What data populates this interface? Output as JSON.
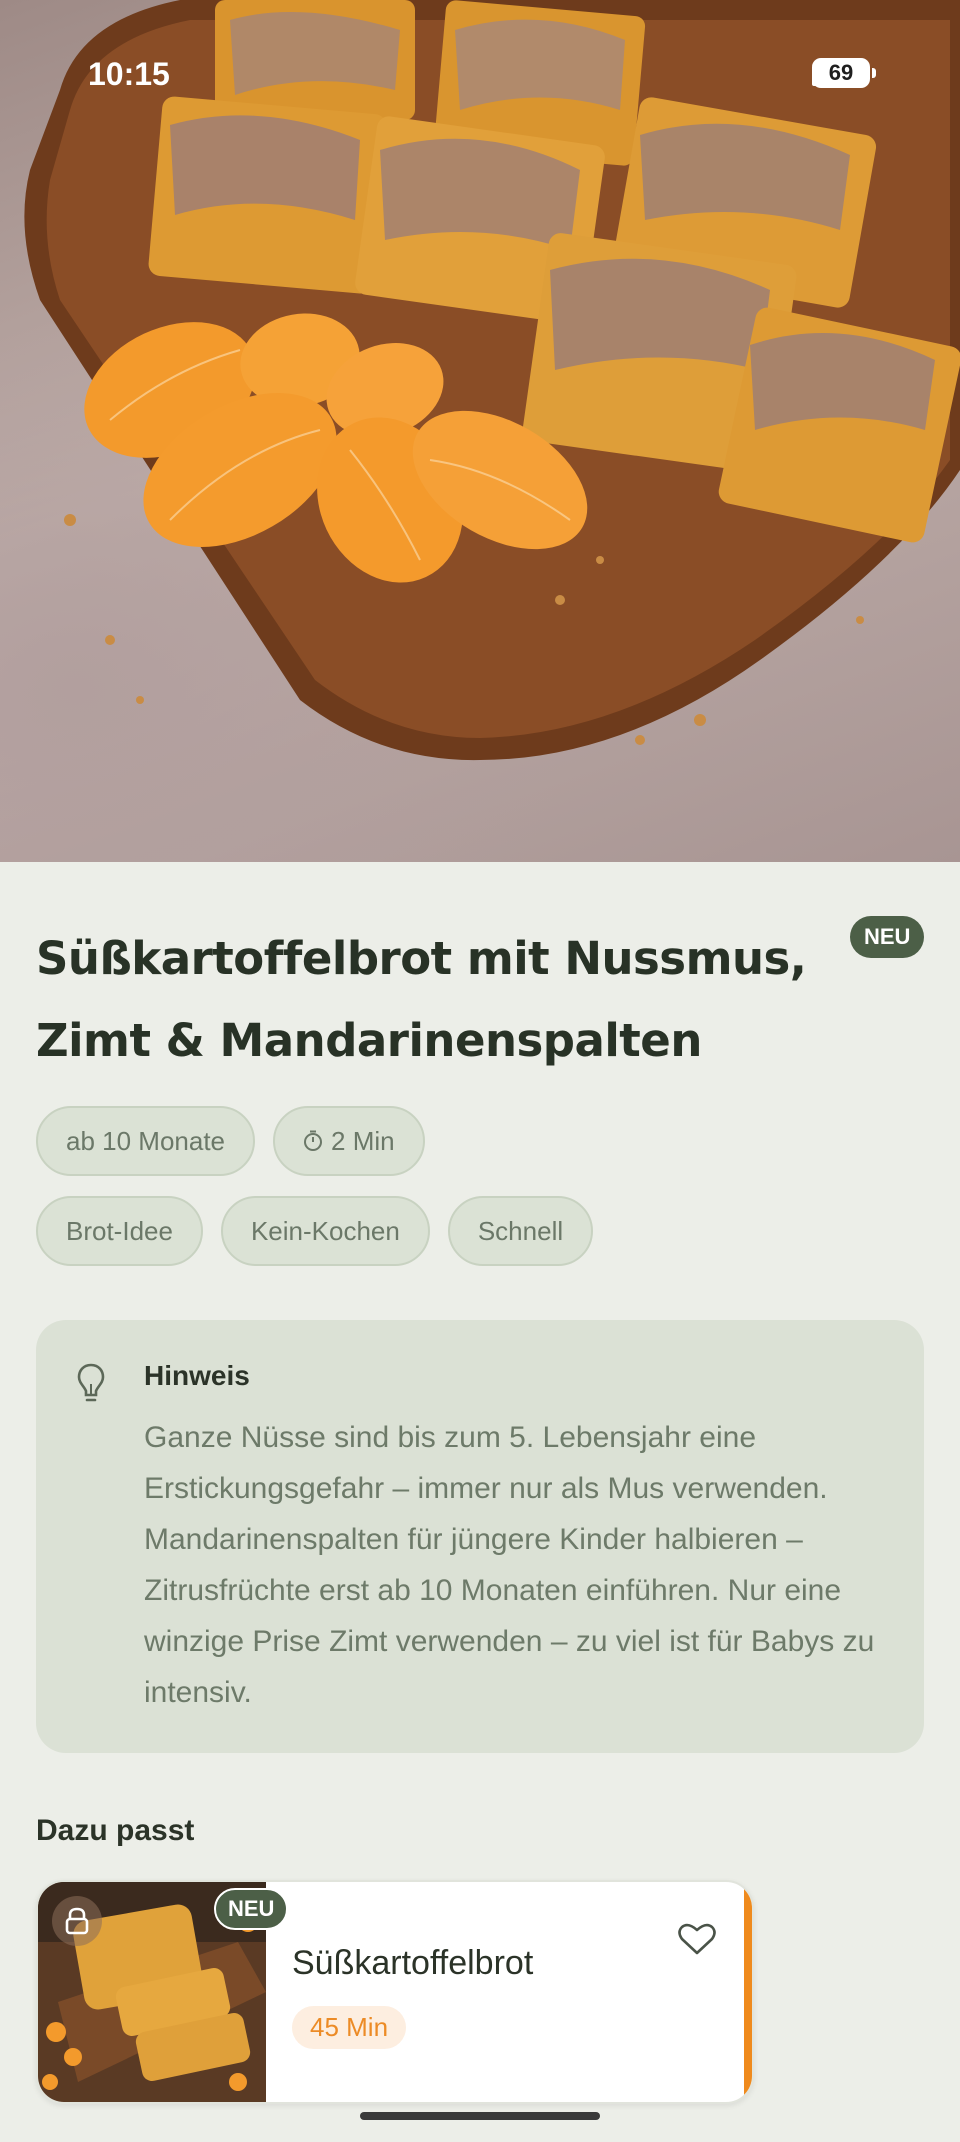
{
  "status_bar": {
    "time": "10:15",
    "battery": "69"
  },
  "recipe": {
    "title": "Süßkartoffelbrot mit Nussmus, Zimt & Mandarinenspalten",
    "badge": "NEU",
    "tags_row1": [
      {
        "label": "ab 10 Monate",
        "icon": ""
      },
      {
        "label": "2 Min",
        "icon": "timer-icon"
      }
    ],
    "tags_row2": [
      {
        "label": "Brot-Idee"
      },
      {
        "label": "Kein-Kochen"
      },
      {
        "label": "Schnell"
      }
    ]
  },
  "hint": {
    "icon": "lightbulb-icon",
    "title": "Hinweis",
    "text": "Ganze Nüsse sind bis zum 5. Lebensjahr eine Erstickungsgefahr – immer nur als Mus verwenden. Mandarinenspalten für jüngere Kinder halbieren – Zitrusfrüchte erst ab 10 Monaten einführen. Nur eine winzige Prise Zimt verwenden – zu viel ist für Babys zu intensiv."
  },
  "related": {
    "section_title": "Dazu passt",
    "cards": [
      {
        "title": "Süßkartoffelbrot",
        "time": "45 Min",
        "badge": "NEU",
        "locked": true,
        "accent": "#ef8a1d"
      }
    ]
  },
  "colors": {
    "background": "#eceee8",
    "badge": "#4c5f47",
    "chip": "#dbe2d5",
    "hint_card": "#dbe1d5",
    "accent_orange": "#ef8a1d"
  }
}
